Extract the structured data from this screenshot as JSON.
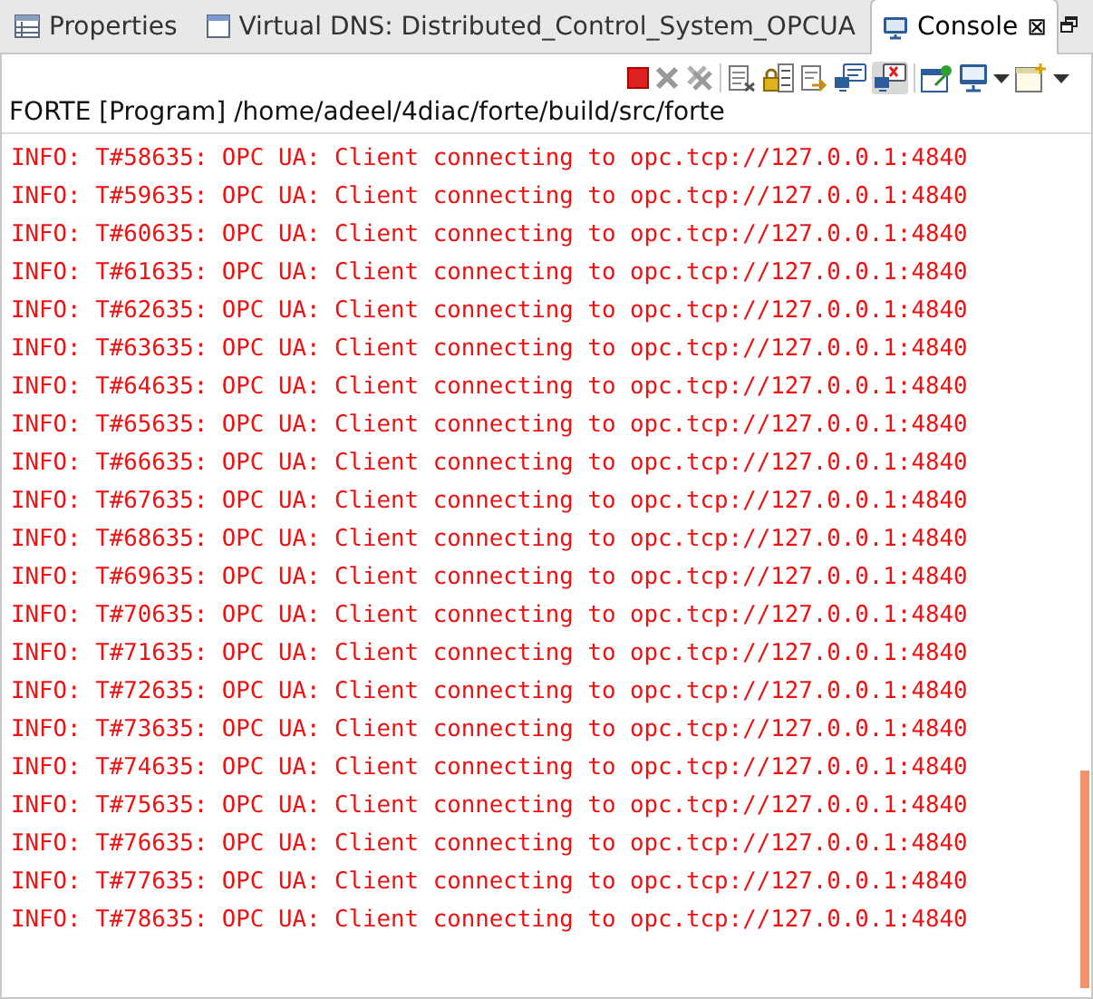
{
  "tabs": [
    {
      "label": "Properties",
      "kind": "table",
      "selected": false
    },
    {
      "label": "Virtual DNS: Distributed_Control_System_OPCUA",
      "kind": "window",
      "selected": false
    },
    {
      "label": "Console",
      "kind": "monitor",
      "selected": true,
      "close": "⊠"
    }
  ],
  "console": {
    "title": "FORTE [Program] /home/adeel/4diac/forte/build/src/forte",
    "lines": [
      "INFO: T#58635: OPC UA: Client connecting to opc.tcp://127.0.0.1:4840",
      "INFO: T#59635: OPC UA: Client connecting to opc.tcp://127.0.0.1:4840",
      "INFO: T#60635: OPC UA: Client connecting to opc.tcp://127.0.0.1:4840",
      "INFO: T#61635: OPC UA: Client connecting to opc.tcp://127.0.0.1:4840",
      "INFO: T#62635: OPC UA: Client connecting to opc.tcp://127.0.0.1:4840",
      "INFO: T#63635: OPC UA: Client connecting to opc.tcp://127.0.0.1:4840",
      "INFO: T#64635: OPC UA: Client connecting to opc.tcp://127.0.0.1:4840",
      "INFO: T#65635: OPC UA: Client connecting to opc.tcp://127.0.0.1:4840",
      "INFO: T#66635: OPC UA: Client connecting to opc.tcp://127.0.0.1:4840",
      "INFO: T#67635: OPC UA: Client connecting to opc.tcp://127.0.0.1:4840",
      "INFO: T#68635: OPC UA: Client connecting to opc.tcp://127.0.0.1:4840",
      "INFO: T#69635: OPC UA: Client connecting to opc.tcp://127.0.0.1:4840",
      "INFO: T#70635: OPC UA: Client connecting to opc.tcp://127.0.0.1:4840",
      "INFO: T#71635: OPC UA: Client connecting to opc.tcp://127.0.0.1:4840",
      "INFO: T#72635: OPC UA: Client connecting to opc.tcp://127.0.0.1:4840",
      "INFO: T#73635: OPC UA: Client connecting to opc.tcp://127.0.0.1:4840",
      "INFO: T#74635: OPC UA: Client connecting to opc.tcp://127.0.0.1:4840",
      "INFO: T#75635: OPC UA: Client connecting to opc.tcp://127.0.0.1:4840",
      "INFO: T#76635: OPC UA: Client connecting to opc.tcp://127.0.0.1:4840",
      "INFO: T#77635: OPC UA: Client connecting to opc.tcp://127.0.0.1:4840",
      "INFO: T#78635: OPC UA: Client connecting to opc.tcp://127.0.0.1:4840"
    ]
  }
}
